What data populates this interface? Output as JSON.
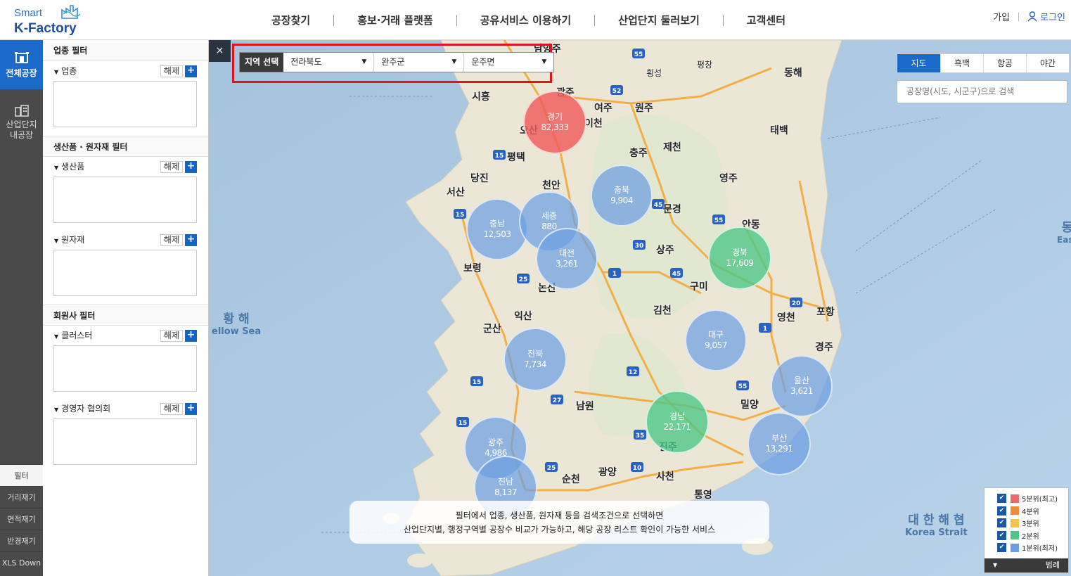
{
  "header": {
    "logo_top": "Smart",
    "logo_bottom": "K-Factory",
    "nav": [
      "공장찾기",
      "홍보·거래 플랫폼",
      "공유서비스 이용하기",
      "산업단지 둘러보기",
      "고객센터"
    ],
    "join": "가입",
    "login": "로그인"
  },
  "leftnav": {
    "all_factory": "전체공장",
    "industrial": "산업단지\n내공장",
    "bottom": [
      "필터",
      "거리재기",
      "면적재기",
      "반경재기",
      "XLS Down"
    ]
  },
  "filters": {
    "industry_title": "업종 필터",
    "industry_label": "업종",
    "product_title": "생산품 · 원자재 필터",
    "product_label": "생산품",
    "material_label": "원자재",
    "member_title": "회원사 필터",
    "cluster_label": "클러스터",
    "ceo_label": "경영자 협의회",
    "release": "해제",
    "add": "+"
  },
  "map": {
    "close": "×",
    "region_label": "지역 선택",
    "region_sido": "전라북도",
    "region_sigungu": "완주군",
    "region_eupmyeon": "운주면",
    "map_types": [
      "지도",
      "흑백",
      "항공",
      "야간"
    ],
    "search_placeholder": "공장명(시도, 시군구)으로 검색",
    "info_line1": "필터에서 업종, 생산품, 원자재 등을 검색조건으로 선택하면",
    "info_line2": "산업단지별, 행정구역별 공장수 비교가 가능하고, 해당 공장 리스트 확인이 가능한 서비스",
    "sea_west": "황 해",
    "sea_west_en": "ellow Sea",
    "sea_strait": "대 한 해 협",
    "sea_strait_en": "Korea Strait",
    "east_label": "동",
    "east_en": "East"
  },
  "clusters": [
    {
      "name": "경기",
      "count": "82,333",
      "color": "red"
    },
    {
      "name": "충북",
      "count": "9,904",
      "color": "blue"
    },
    {
      "name": "충남",
      "count": "12,503",
      "color": "blue"
    },
    {
      "name": "세종",
      "count": "880",
      "color": "blue"
    },
    {
      "name": "대전",
      "count": "3,261",
      "color": "blue"
    },
    {
      "name": "경북",
      "count": "17,609",
      "color": "green"
    },
    {
      "name": "대구",
      "count": "9,057",
      "color": "blue"
    },
    {
      "name": "전북",
      "count": "7,734",
      "color": "blue"
    },
    {
      "name": "울산",
      "count": "3,621",
      "color": "blue"
    },
    {
      "name": "경남",
      "count": "22,171",
      "color": "green"
    },
    {
      "name": "부산",
      "count": "13,291",
      "color": "blue"
    },
    {
      "name": "광주",
      "count": "4,986",
      "color": "blue"
    },
    {
      "name": "전남",
      "count": "8,137",
      "color": "blue"
    }
  ],
  "cities": [
    "남양주",
    "횡성",
    "평창",
    "동해",
    "광주",
    "여주",
    "원주",
    "시흥",
    "오산",
    "이천",
    "제천",
    "충주",
    "태백",
    "평택",
    "당진",
    "천안",
    "영주",
    "서산",
    "문경",
    "안동",
    "상주",
    "보령",
    "구미",
    "논산",
    "김천",
    "영천",
    "포항",
    "익산",
    "군산",
    "경주",
    "남원",
    "밀양",
    "진주",
    "광양",
    "순천",
    "사천",
    "통영"
  ],
  "legend": {
    "items": [
      {
        "label": "5분위(최고)",
        "color": "#ee6a6a"
      },
      {
        "label": "4분위",
        "color": "#f08a3c"
      },
      {
        "label": "3분위",
        "color": "#f5c34a"
      },
      {
        "label": "2분위",
        "color": "#52c48a"
      },
      {
        "label": "1분위(최저)",
        "color": "#6c9fe2"
      }
    ],
    "footer": "범례",
    "check": "✔"
  }
}
